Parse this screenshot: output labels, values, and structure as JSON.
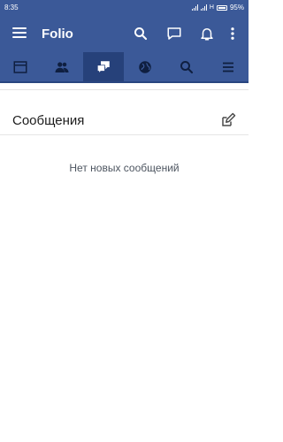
{
  "status_bar": {
    "time": "8:35",
    "network": "H",
    "battery": "95%"
  },
  "app_bar": {
    "title": "Folio",
    "icons": [
      "menu-icon",
      "search-icon",
      "messenger-icon",
      "bell-icon",
      "more-vertical-icon"
    ]
  },
  "tabs": [
    {
      "name": "news-feed",
      "icon": "news-feed-icon",
      "active": false
    },
    {
      "name": "friends",
      "icon": "friends-icon",
      "active": false
    },
    {
      "name": "messages",
      "icon": "messages-icon",
      "active": true
    },
    {
      "name": "globe",
      "icon": "globe-icon",
      "active": false
    },
    {
      "name": "search",
      "icon": "search-icon",
      "active": false
    },
    {
      "name": "menu",
      "icon": "menu-icon",
      "active": false
    }
  ],
  "messages": {
    "title": "Сообщения",
    "empty_text": "Нет новых сообщений"
  },
  "colors": {
    "brand": "#3b5998",
    "active_tab": "#26417a"
  }
}
